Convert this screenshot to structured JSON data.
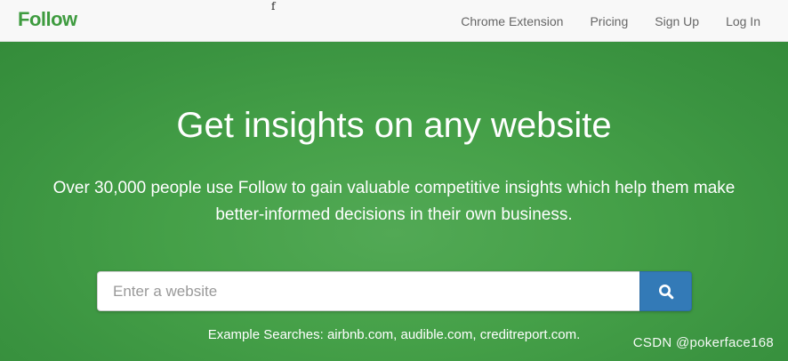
{
  "brand": {
    "logo_text": "Follow",
    "color": "#3e9b3f"
  },
  "stray_text": "f",
  "nav": {
    "items": [
      {
        "label": "Chrome Extension"
      },
      {
        "label": "Pricing"
      },
      {
        "label": "Sign Up"
      },
      {
        "label": "Log In"
      }
    ]
  },
  "hero": {
    "title": "Get insights on any website",
    "subtitle": "Over 30,000 people use Follow to gain valuable competitive insights which help them make better-informed decisions in their own business.",
    "background_color": "#45a048"
  },
  "search": {
    "placeholder": "Enter a website",
    "value": "",
    "button_icon": "search-icon",
    "button_color": "#337ab7"
  },
  "examples": {
    "prefix": "Example Searches:",
    "items": [
      "airbnb.com",
      "audible.com",
      "creditreport.com"
    ],
    "suffix": "."
  },
  "watermark": "CSDN @pokerface168"
}
